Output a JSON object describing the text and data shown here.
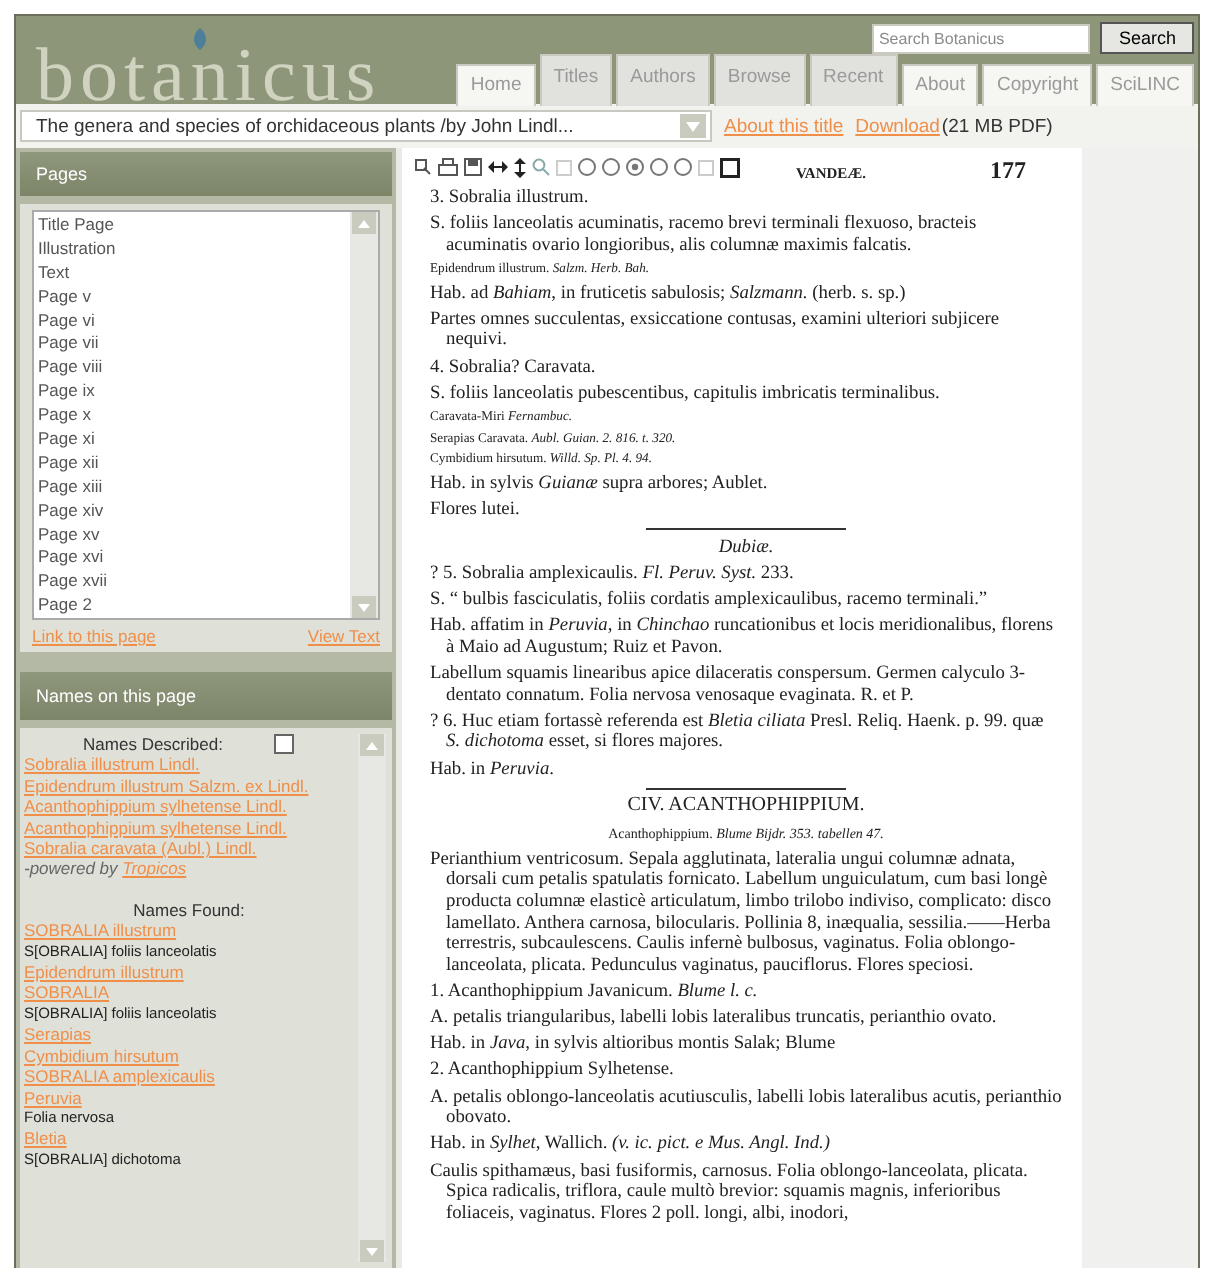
{
  "logo": {
    "text": "botanicus"
  },
  "search": {
    "placeholder": "Search Botanicus",
    "button": "Search"
  },
  "tabs": [
    {
      "label": "Home",
      "kind": "plain",
      "selected": false
    },
    {
      "label": "Titles",
      "kind": "raised",
      "selected": false
    },
    {
      "label": "Authors",
      "kind": "raised",
      "selected": false
    },
    {
      "label": "Browse",
      "kind": "raised",
      "selected": false
    },
    {
      "label": "Recent",
      "kind": "raised",
      "selected": false
    },
    {
      "label": "About",
      "kind": "plain",
      "selected": false
    },
    {
      "label": "Copyright",
      "kind": "plain",
      "selected": false
    },
    {
      "label": "SciLINC",
      "kind": "plain",
      "selected": false
    }
  ],
  "title_bar": {
    "select_value": "The genera and species of orchidaceous plants /by John Lindl...",
    "links": [
      "About this title",
      "Download"
    ],
    "note": "(21 MB PDF)"
  },
  "pages_panel": {
    "title": "Pages",
    "items": [
      {
        "label": "Title Page",
        "selected": false
      },
      {
        "label": "Illustration",
        "selected": false
      },
      {
        "label": "Text",
        "selected": false
      },
      {
        "label": "Page v",
        "selected": false
      },
      {
        "label": "Page vi",
        "selected": false
      },
      {
        "label": "Page vii",
        "selected": false
      },
      {
        "label": "Page viii",
        "selected": false
      },
      {
        "label": "Page ix",
        "selected": false
      },
      {
        "label": "Page x",
        "selected": false
      },
      {
        "label": "Page xi",
        "selected": false
      },
      {
        "label": "Page xii",
        "selected": false
      },
      {
        "label": "Page xiii",
        "selected": false
      },
      {
        "label": "Page xiv",
        "selected": false
      },
      {
        "label": "Page xv",
        "selected": false
      },
      {
        "label": "Page xvi",
        "selected": false
      },
      {
        "label": "Page xvii",
        "selected": false
      },
      {
        "label": "Page 2",
        "selected": false
      }
    ],
    "links": [
      "Link to this page",
      "View Text"
    ]
  },
  "names_panel": {
    "title": "Names on this page",
    "described_heading": "Names Described:",
    "described_checked": false,
    "described": [
      "Sobralia illustrum Lindl.",
      "Epidendrum illustrum Salzm. ex Lindl.",
      "Acanthophippium sylhetense Lindl.",
      "Acanthophippium sylhetense Lindl.",
      "Sobralia caravata (Aubl.) Lindl."
    ],
    "powered_prefix": "-powered by",
    "powered_link": "Tropicos",
    "found_heading": "Names Found:",
    "found": [
      {
        "text": "SOBRALIA illustrum",
        "kind": "link"
      },
      {
        "text": "S[OBRALIA] foliis lanceolatis",
        "kind": "plain"
      },
      {
        "text": "Epidendrum illustrum",
        "kind": "link"
      },
      {
        "text": "SOBRALIA",
        "kind": "link"
      },
      {
        "text": "S[OBRALIA] foliis lanceolatis",
        "kind": "plain"
      },
      {
        "text": "Serapias",
        "kind": "link"
      },
      {
        "text": "Cymbidium hirsutum",
        "kind": "link"
      },
      {
        "text": "SOBRALIA amplexicaulis",
        "kind": "link"
      },
      {
        "text": "Peruvia",
        "kind": "link"
      },
      {
        "text": "Folia nervosa",
        "kind": "plain"
      },
      {
        "text": "Bletia",
        "kind": "link"
      },
      {
        "text": "S[OBRALIA] dichotoma",
        "kind": "plain"
      }
    ]
  },
  "viewer": {
    "running_head": "VANDEÆ.",
    "page_number": "177",
    "blocks": [
      {
        "kind": "entry",
        "text": "3. Sobralia illustrum."
      },
      {
        "kind": "para",
        "text": "S. foliis lanceolatis acuminatis, racemo brevi terminali flexuoso, bracteis acuminatis ovario longioribus, alis columnæ maximis falcatis."
      },
      {
        "kind": "synonym",
        "text": "Epidendrum illustrum.   *Salzm. Herb. Bah.*"
      },
      {
        "kind": "para",
        "text": "Hab. ad *Bahiam*, in fruticetis sabulosis; *Salzmann.* (herb. s. sp.)"
      },
      {
        "kind": "para",
        "text": "Partes omnes succulentas, exsiccatione contusas, examini ulteriori subjicere nequivi."
      },
      {
        "kind": "entry",
        "text": "4. Sobralia? Caravata."
      },
      {
        "kind": "para",
        "text": "S. foliis lanceolatis pubescentibus, capitulis imbricatis terminalibus."
      },
      {
        "kind": "synonym",
        "text": "Caravata-Miri *Fernambuc.*"
      },
      {
        "kind": "synonym",
        "text": "Serapias Caravata.   *Aubl. Guian. 2. 816. t. 320.*"
      },
      {
        "kind": "synonym",
        "text": "Cymbidium hirsutum.   *Willd. Sp. Pl. 4. 94.*"
      },
      {
        "kind": "para",
        "text": "Hab. in sylvis *Guianæ* supra arbores; Aublet."
      },
      {
        "kind": "para",
        "text": "Flores lutei."
      },
      {
        "kind": "rule"
      },
      {
        "kind": "section",
        "text": "Dubiæ."
      },
      {
        "kind": "entry",
        "text": "? 5. Sobralia amplexicaulis.   *Fl. Peruv. Syst.* 233."
      },
      {
        "kind": "para",
        "text": "S. “ bulbis fasciculatis, foliis cordatis amplexicaulibus, racemo terminali.”"
      },
      {
        "kind": "para",
        "text": "Hab. affatim in *Peruvia*, in *Chinchao* runcationibus et locis meridionalibus, florens à Maio ad Augustum; Ruiz et Pavon."
      },
      {
        "kind": "para",
        "text": "Labellum squamis linearibus apice dilaceratis conspersum. Germen calyculo 3-dentato connatum. Folia nervosa venosaque evaginata. R. et P."
      },
      {
        "kind": "para",
        "text": "? 6. Huc etiam fortassè referenda est *Bletia ciliata* Presl. Reliq. Haenk. p. 99. quæ *S. dichotoma* esset, si flores majores."
      },
      {
        "kind": "para",
        "text": "Hab. in *Peruvia*."
      },
      {
        "kind": "rule"
      },
      {
        "kind": "title",
        "text": "CIV. ACANTHOPHIPPIUM."
      },
      {
        "kind": "subtitle",
        "text": "Acanthophippium.   *Blume Bijdr. 353. tabellen 47.*"
      },
      {
        "kind": "para",
        "text": "Perianthium ventricosum. Sepala agglutinata, lateralia ungui columnæ adnata, dorsali cum petalis spatulatis fornicato. Labellum unguiculatum, cum basi longè producta columnæ elasticè articulatum, limbo trilobo indiviso, complicato: disco lamellato. Anthera carnosa, bilocularis. Pollinia 8, inæqualia, sessilia.——Herba terrestris, subcaulescens. Caulis infernè bulbosus, vaginatus. Folia oblongo-lanceolata, plicata. Pedunculus vaginatus, pauciflorus. Flores speciosi."
      },
      {
        "kind": "entry",
        "text": "1. Acanthophippium Javanicum.   *Blume l. c.*"
      },
      {
        "kind": "para",
        "text": "A. petalis triangularibus, labelli lobis lateralibus truncatis, perianthio ovato."
      },
      {
        "kind": "para",
        "text": "Hab. in *Java*, in sylvis altioribus montis Salak; Blume"
      },
      {
        "kind": "entry",
        "text": "2. Acanthophippium Sylhetense."
      },
      {
        "kind": "para",
        "text": "A. petalis oblongo-lanceolatis acutiusculis, labelli lobis lateralibus acutis, perianthio obovato."
      },
      {
        "kind": "para",
        "text": "Hab. in *Sylhet*, Wallich. *(v. ic. pict. e Mus. Angl. Ind.)*"
      },
      {
        "kind": "para",
        "text": "Caulis spithamæus, basi fusiformis, carnosus. Folia oblongo-lanceolata, plicata. Spica radicalis, triflora, caule multò brevior: squamis magnis, inferioribus foliaceis, vaginatus. Flores 2 poll. longi, albi, inodori,"
      }
    ]
  }
}
